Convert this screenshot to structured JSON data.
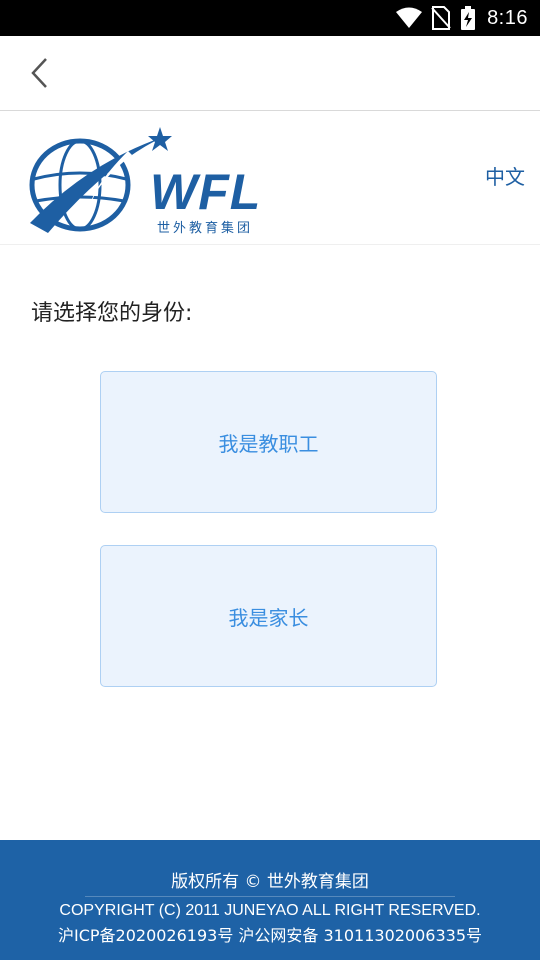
{
  "status_bar": {
    "time": "8:16",
    "icons": [
      "wifi-icon",
      "no-sim-icon",
      "battery-charging-icon"
    ]
  },
  "nav": {
    "back_icon": "chevron-left-icon"
  },
  "header": {
    "logo_text": "WFL",
    "logo_subtitle": "世外教育集团",
    "language_toggle": "中文"
  },
  "main": {
    "prompt": "请选择您的身份:",
    "roles": [
      {
        "label": "我是教职工"
      },
      {
        "label": "我是家长"
      }
    ]
  },
  "footer": {
    "rights": "版权所有 © 世外教育集团",
    "copyright": "COPYRIGHT (C) 2011 JUNEYAO ALL RIGHT RESERVED.",
    "icp": "沪ICP备2020026193号  沪公网安备 31011302006335号"
  },
  "colors": {
    "brand_blue": "#1e62a6",
    "button_bg": "#ebf3fd",
    "button_border": "#aed0f3",
    "button_text": "#3a8ee0"
  }
}
